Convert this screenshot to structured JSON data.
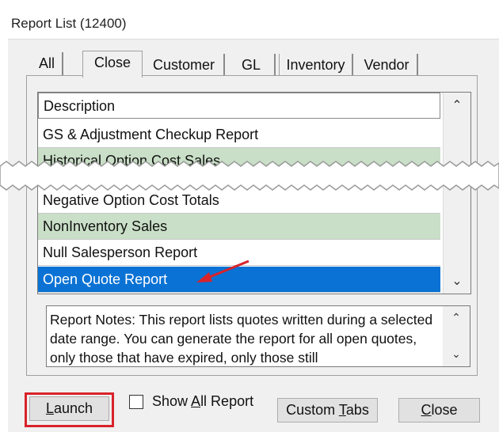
{
  "window": {
    "title": "Report List (12400)"
  },
  "tabs": [
    {
      "label": "All",
      "active": false
    },
    {
      "label": "Close",
      "active": true
    },
    {
      "label": "Customer",
      "active": false
    },
    {
      "label": "GL",
      "active": false
    },
    {
      "label": "Inventory",
      "active": false
    },
    {
      "label": "Vendor",
      "active": false
    }
  ],
  "report_list": {
    "header": "Description",
    "rows": [
      {
        "label": "GS & Adjustment Checkup Report",
        "highlight": "none"
      },
      {
        "label": "Historical Option Cost Sales",
        "highlight": "green"
      },
      {
        "label": "Negative Option Cost Totals",
        "highlight": "none"
      },
      {
        "label": "NonInventory Sales",
        "highlight": "green"
      },
      {
        "label": "Null Salesperson Report",
        "highlight": "none"
      },
      {
        "label": "Open Quote Report",
        "highlight": "selected"
      }
    ]
  },
  "notes": {
    "text": "Report Notes:  This report lists quotes written during a selected date range. You can generate the report for all open quotes, only those that have expired, only those still"
  },
  "buttons": {
    "launch_pre": "",
    "launch_u": "L",
    "launch_post": "aunch",
    "show_all_pre": "Show ",
    "show_all_u": "A",
    "show_all_post": "ll Report",
    "custom_tabs_pre": "Custom ",
    "custom_tabs_u": "T",
    "custom_tabs_post": "abs",
    "close_pre": "",
    "close_u": "C",
    "close_post": "lose"
  },
  "show_all_checked": false,
  "colors": {
    "selected_row": "#0a72d4",
    "green_row": "#c9dfc7",
    "annotation": "#d8232a"
  }
}
